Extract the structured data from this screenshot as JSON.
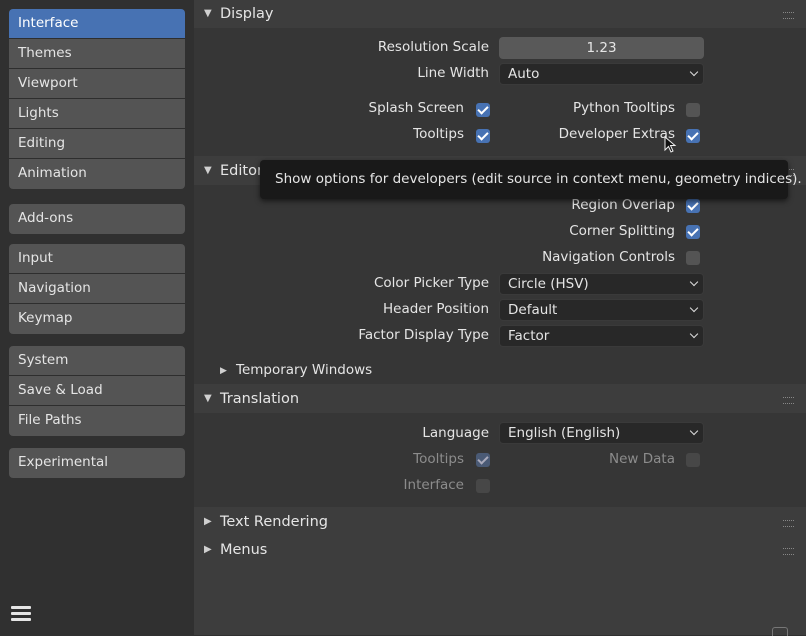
{
  "sidebar": {
    "groups": [
      {
        "items": [
          "Interface",
          "Themes",
          "Viewport",
          "Lights",
          "Editing",
          "Animation"
        ]
      },
      {
        "items": [
          "Add-ons"
        ]
      },
      {
        "items": [
          "Input",
          "Navigation",
          "Keymap"
        ]
      },
      {
        "items": [
          "System",
          "Save & Load",
          "File Paths"
        ]
      },
      {
        "items": [
          "Experimental"
        ]
      }
    ],
    "active": "Interface"
  },
  "display": {
    "title": "Display",
    "resolution_scale_label": "Resolution Scale",
    "resolution_scale_value": "1.23",
    "line_width_label": "Line Width",
    "line_width_value": "Auto",
    "splash_screen_label": "Splash Screen",
    "splash_screen_checked": true,
    "tooltips_label": "Tooltips",
    "tooltips_checked": true,
    "python_tooltips_label": "Python Tooltips",
    "python_tooltips_checked": false,
    "developer_extras_label": "Developer Extras",
    "developer_extras_checked": true
  },
  "editors": {
    "title_visible": "Editor",
    "region_overlap_label": "Region Overlap",
    "region_overlap_checked": true,
    "corner_splitting_label": "Corner Splitting",
    "corner_splitting_checked": true,
    "navigation_controls_label": "Navigation Controls",
    "navigation_controls_checked": false,
    "color_picker_label": "Color Picker Type",
    "color_picker_value": "Circle (HSV)",
    "header_position_label": "Header Position",
    "header_position_value": "Default",
    "factor_display_label": "Factor Display Type",
    "factor_display_value": "Factor",
    "temporary_windows_label": "Temporary Windows"
  },
  "translation": {
    "title": "Translation",
    "language_label": "Language",
    "language_value": "English (English)",
    "tooltips_label": "Tooltips",
    "tooltips_checked": true,
    "new_data_label": "New Data",
    "new_data_checked": false,
    "interface_label": "Interface",
    "interface_checked": false
  },
  "text_rendering": {
    "title": "Text Rendering"
  },
  "menus": {
    "title": "Menus"
  },
  "tooltip": {
    "text": "Show options for developers (edit source in context menu, geometry indices)."
  },
  "colors": {
    "accent": "#4772b3",
    "panel": "#3d3d3d",
    "sidebar": "#303030"
  }
}
